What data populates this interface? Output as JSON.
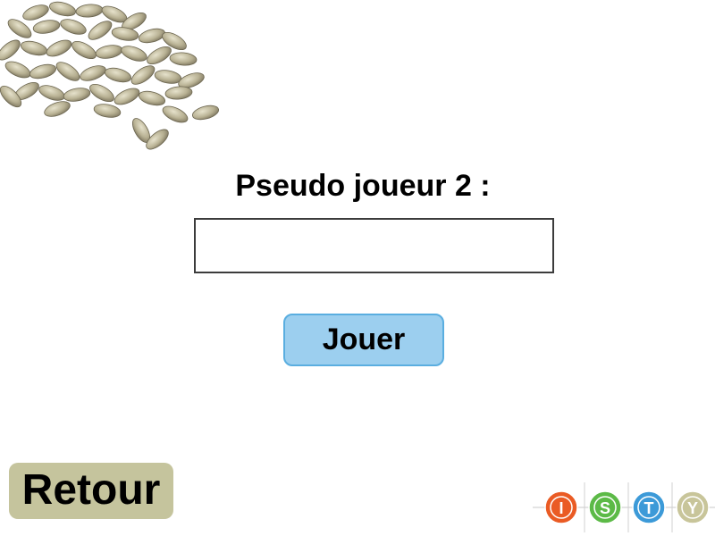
{
  "app": {
    "prompt_label": "Pseudo joueur 2 :",
    "player_input": {
      "value": "",
      "placeholder": ""
    },
    "play_button_label": "Jouer",
    "back_button_label": "Retour"
  },
  "logo": {
    "letters": [
      "I",
      "S",
      "T",
      "Y"
    ],
    "colors": [
      "#ea5b24",
      "#5cba47",
      "#3c9ad8",
      "#c8c59a"
    ]
  },
  "colors": {
    "play_button_bg": "#9ccfef",
    "back_button_bg": "#c5c49d"
  },
  "icons": {
    "seeds_image": "sunflower-seeds-image"
  }
}
